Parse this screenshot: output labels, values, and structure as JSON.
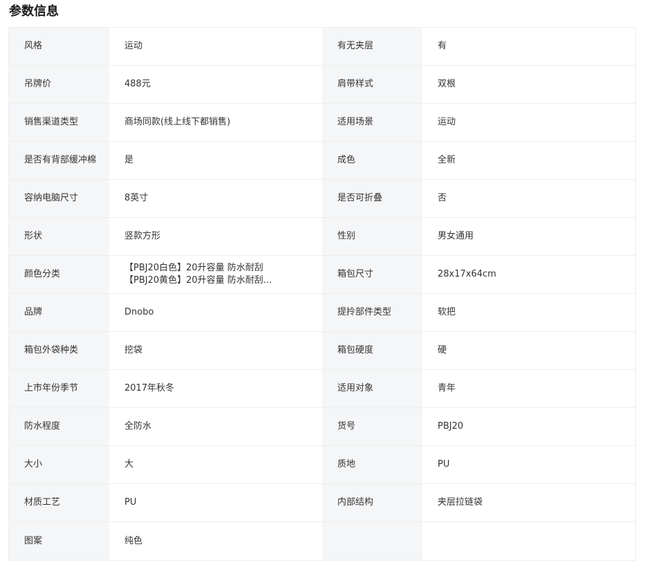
{
  "title": "参数信息",
  "rows": [
    {
      "k1": "风格",
      "v1": "运动",
      "k2": "有无夹层",
      "v2": "有"
    },
    {
      "k1": "吊牌价",
      "v1": "488元",
      "k2": "肩带样式",
      "v2": "双根"
    },
    {
      "k1": "销售渠道类型",
      "v1": "商场同款(线上线下都销售)",
      "k2": "适用场景",
      "v2": "运动"
    },
    {
      "k1": "是否有背部缓冲棉",
      "v1": "是",
      "k2": "成色",
      "v2": "全新"
    },
    {
      "k1": "容纳电脑尺寸",
      "v1": "8英寸",
      "k2": "是否可折叠",
      "v2": "否"
    },
    {
      "k1": "形状",
      "v1": "竖款方形",
      "k2": "性别",
      "v2": "男女通用"
    },
    {
      "k1": "颜色分类",
      "v1_line1": "【PBJ20白色】20升容量 防水耐刮",
      "v1_line2": "【PBJ20黄色】20升容量 防水耐刮...",
      "k2": "箱包尺寸",
      "v2": "28x17x64cm"
    },
    {
      "k1": "品牌",
      "v1": "Dnobo",
      "k2": "提拎部件类型",
      "v2": "软把"
    },
    {
      "k1": "箱包外袋种类",
      "v1": "挖袋",
      "k2": "箱包硬度",
      "v2": "硬"
    },
    {
      "k1": "上市年份季节",
      "v1": "2017年秋冬",
      "k2": "适用对象",
      "v2": "青年"
    },
    {
      "k1": "防水程度",
      "v1": "全防水",
      "k2": "货号",
      "v2": "PBJ20"
    },
    {
      "k1": "大小",
      "v1": "大",
      "k2": "质地",
      "v2": "PU"
    },
    {
      "k1": "材质工艺",
      "v1": "PU",
      "k2": "内部结构",
      "v2": "夹层拉链袋"
    },
    {
      "k1": "图案",
      "v1": "纯色",
      "k2": "",
      "v2": ""
    }
  ]
}
